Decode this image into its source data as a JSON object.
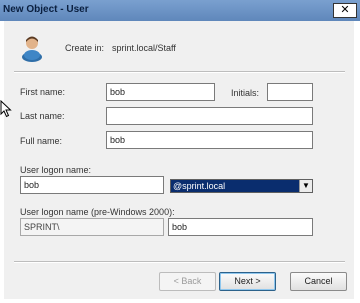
{
  "window": {
    "title": "New Object - User",
    "close_glyph": "✕"
  },
  "header": {
    "create_in_label": "Create in:",
    "create_in_path": "sprint.local/Staff",
    "icon": "user-icon"
  },
  "form": {
    "first_name": {
      "label": "First name:",
      "value": "bob"
    },
    "initials": {
      "label": "Initials:",
      "value": ""
    },
    "last_name": {
      "label": "Last name:",
      "value": ""
    },
    "full_name": {
      "label": "Full name:",
      "value": "bob"
    },
    "logon": {
      "label": "User logon name:",
      "value": "bob",
      "domain": "@sprint.local",
      "dropdown_glyph": "▼"
    },
    "pre2000": {
      "label": "User logon name (pre-Windows 2000):",
      "domain": "SPRINT\\",
      "value": "bob"
    }
  },
  "buttons": {
    "back": "< Back",
    "next": "Next >",
    "cancel": "Cancel"
  },
  "colors": {
    "titlebar": "#6f96c7",
    "selected_domain_bg": "#0a2d6e"
  }
}
